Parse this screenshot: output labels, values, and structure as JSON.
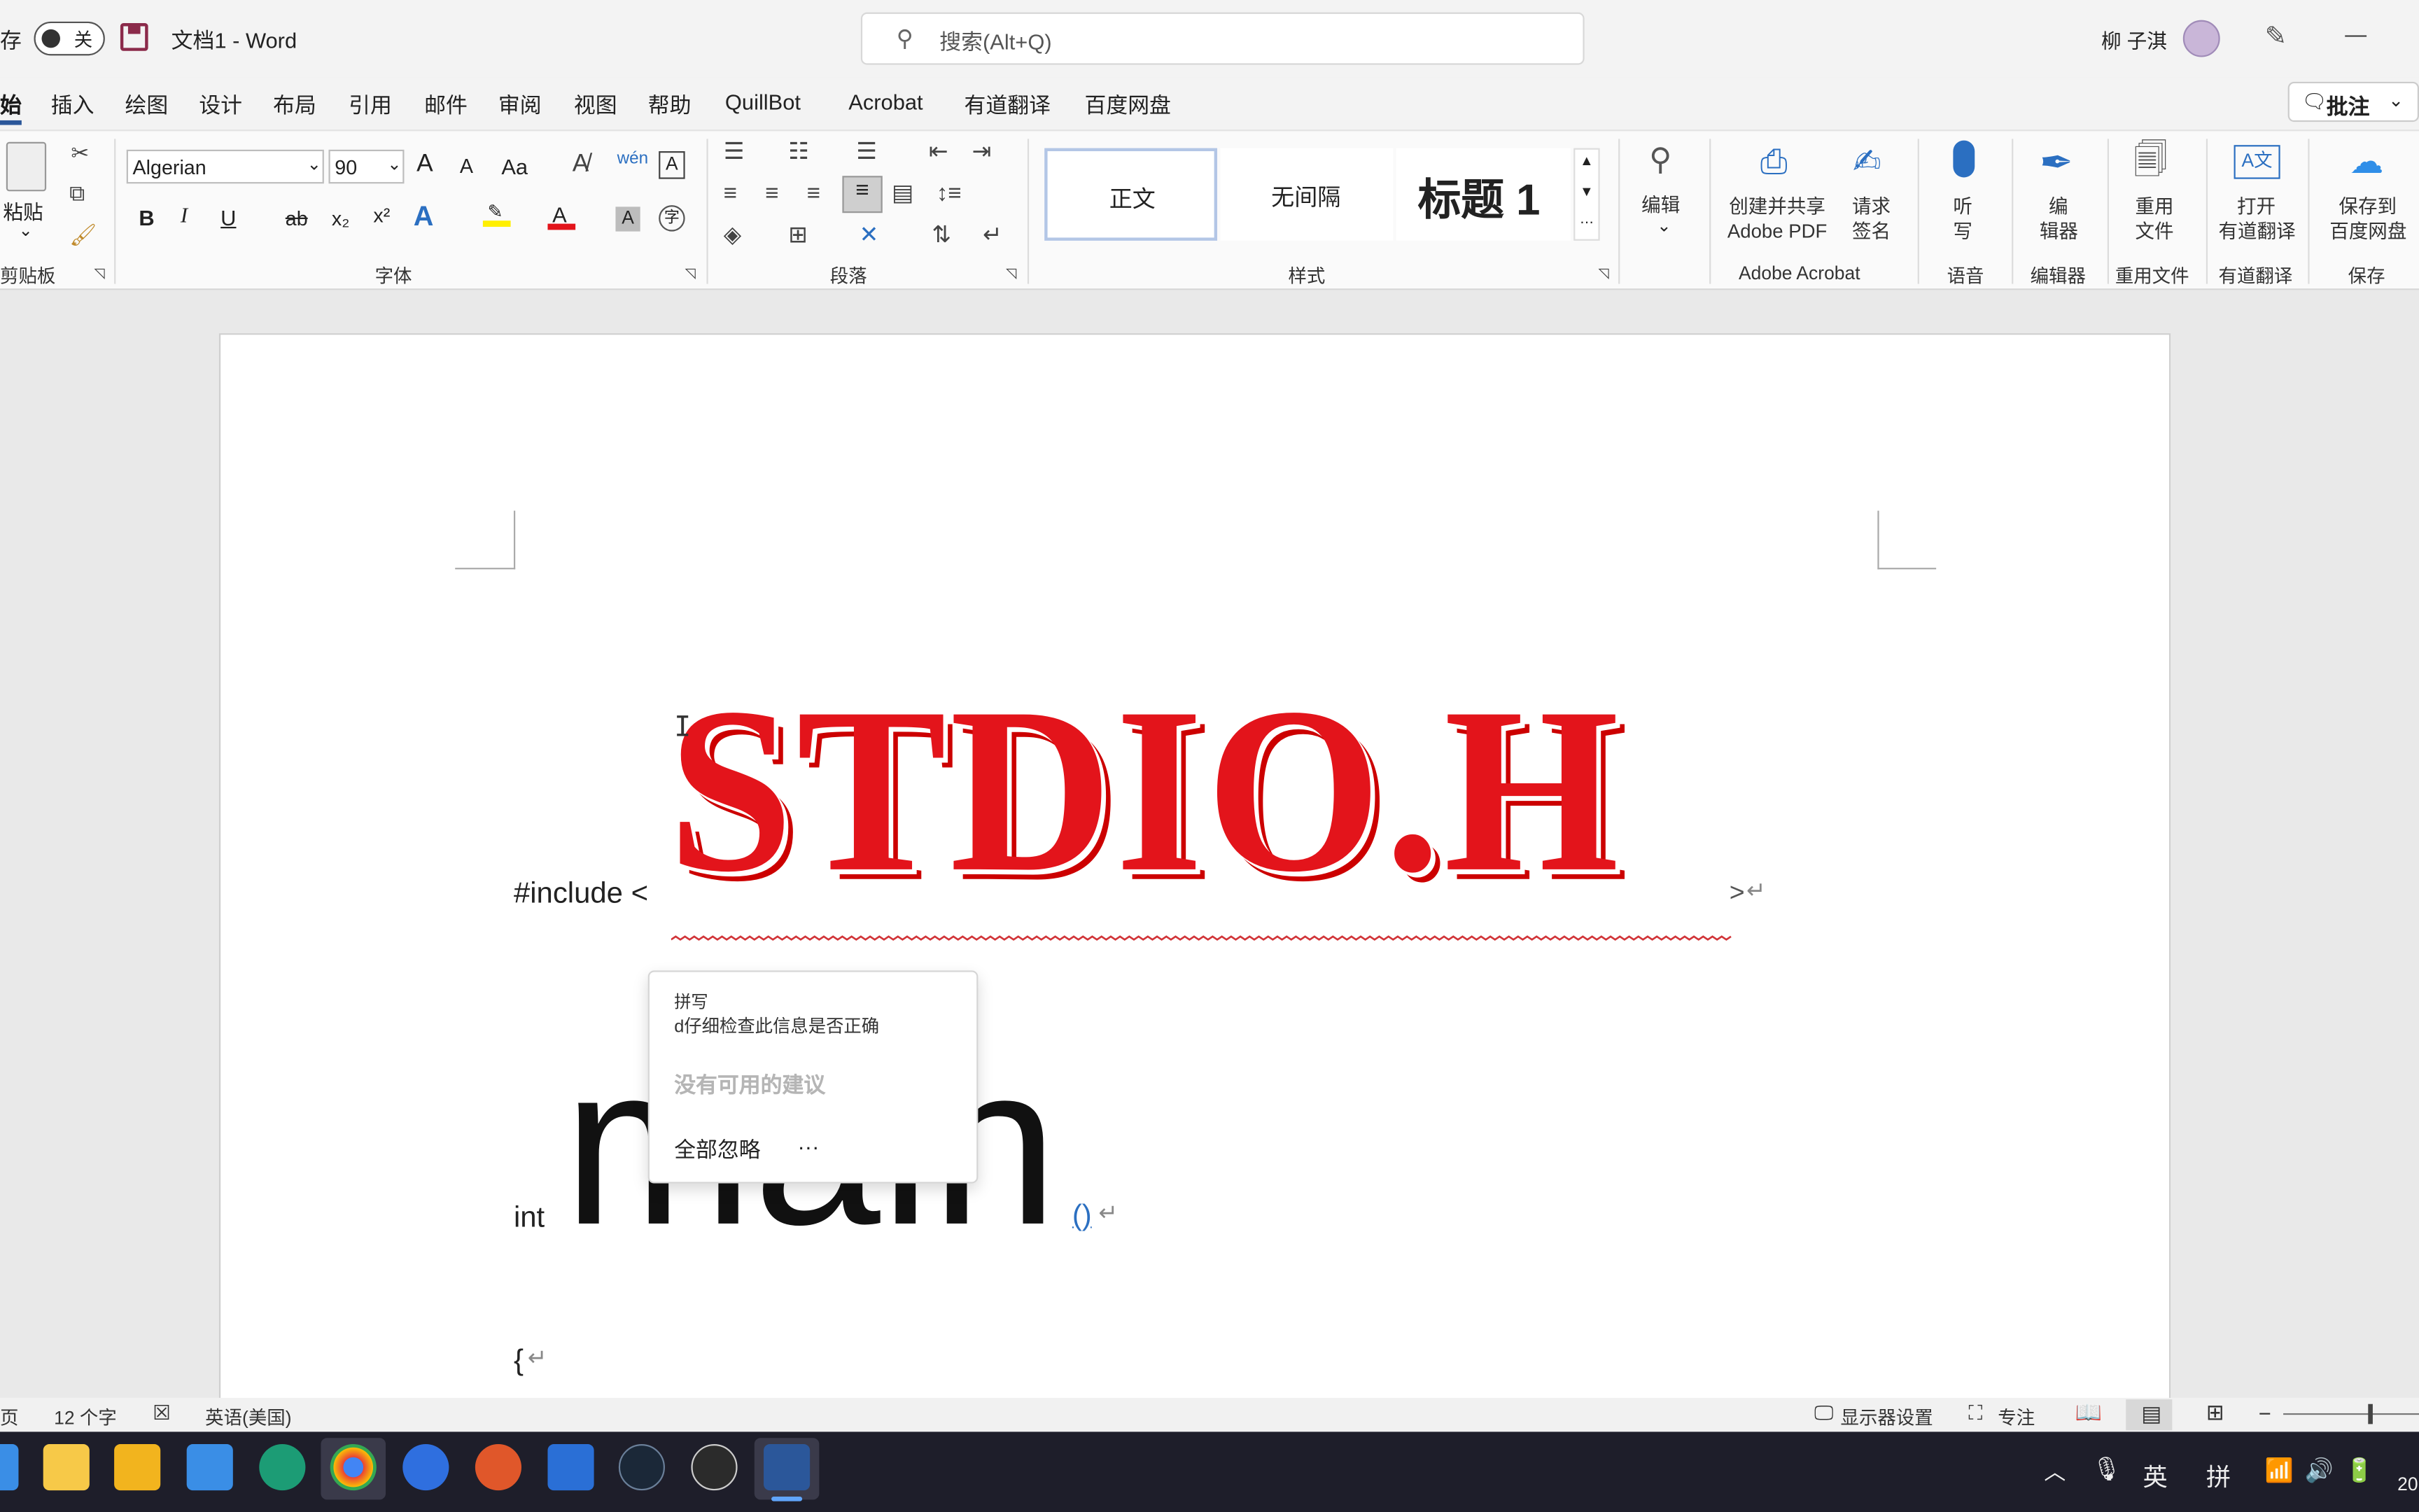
{
  "titlebar": {
    "autosave_label": "存",
    "autosave_state": "关",
    "doc_title": "文档1  -  Word",
    "search_placeholder": "搜索(Alt+Q)",
    "user_name": "柳 子淇",
    "minimize_glyph": "—"
  },
  "tabs": [
    "始",
    "插入",
    "绘图",
    "设计",
    "布局",
    "引用",
    "邮件",
    "审阅",
    "视图",
    "帮助",
    "QuillBot",
    "Acrobat",
    "有道翻译",
    "百度网盘"
  ],
  "comments_button": "批注",
  "ribbon": {
    "clipboard": {
      "paste_label": "粘贴",
      "group": "剪贴板"
    },
    "font": {
      "name": "Algerian",
      "size": "90",
      "grow": "A",
      "shrink": "A",
      "case": "Aa",
      "group": "字体"
    },
    "paragraph": {
      "group": "段落"
    },
    "styles": {
      "normal": "正文",
      "no_spacing": "无间隔",
      "heading1": "标题 1",
      "group": "样式"
    },
    "editing": {
      "label": "编辑"
    },
    "acrobat": {
      "create_share": "创建并共享",
      "adobe_pdf": "Adobe PDF",
      "request": "请求",
      "sign": "签名",
      "group": "Adobe Acrobat"
    },
    "voice": {
      "dictate1": "听",
      "dictate2": "写",
      "group": "语音"
    },
    "editor": {
      "line1": "编",
      "line2": "辑器",
      "group": "编辑器"
    },
    "reuse": {
      "line1": "重用",
      "line2": "文件",
      "group": "重用文件"
    },
    "youdao": {
      "line1": "打开",
      "line2": "有道翻译",
      "group": "有道翻译"
    },
    "baidu": {
      "line1": "保存到",
      "line2": "百度网盘",
      "group": "保存"
    }
  },
  "document": {
    "line1_prefix": "#include <",
    "line1_big": "STDIO.H",
    "line1_suffix": ">",
    "line2_prefix": "int",
    "line2_big": "main",
    "line2_suffix": "()",
    "line3": "{",
    "para_mark": "↵"
  },
  "spell_menu": {
    "title": "拼写",
    "subtitle": "d仔细检查此信息是否正确",
    "no_suggestions": "没有可用的建议",
    "ignore_all": "全部忽略",
    "more": "···"
  },
  "statusbar": {
    "page": "页",
    "word_count": "12 个字",
    "language": "英语(美国)",
    "display_settings": "显示器设置",
    "focus": "专注",
    "zoom_minus": "−"
  },
  "taskbar": {
    "ime_lang": "英",
    "ime_mode": "拼",
    "clock_partial": "20"
  },
  "colors": {
    "accent": "#2b579a",
    "title_red": "#e3141b"
  }
}
